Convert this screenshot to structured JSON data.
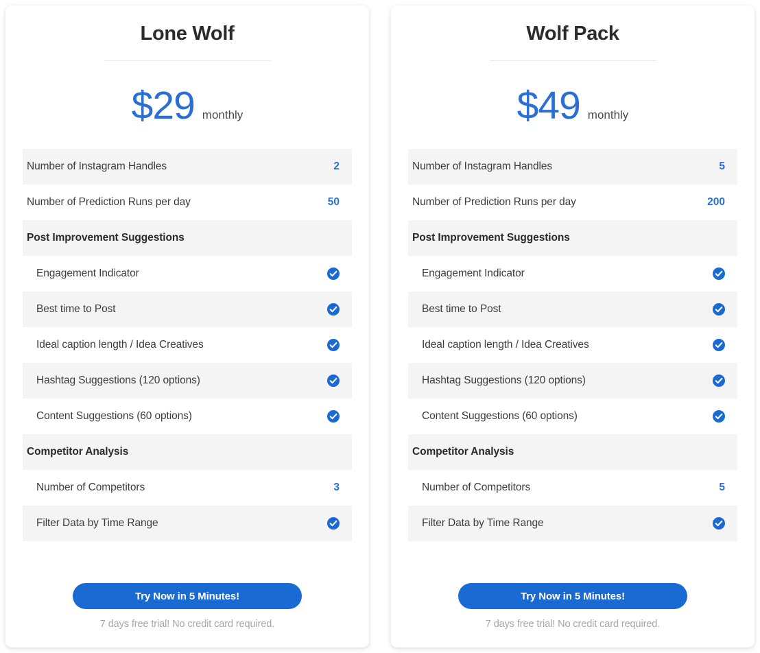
{
  "theme": {
    "accent_blue": "#2b6fd4",
    "button_blue": "#1a6ad4",
    "row_shade": "#f4f4f4",
    "page_background": "#ffffff",
    "text_primary": "#2b2b2b",
    "text_secondary": "#3d3d3d",
    "note_gray": "#a6a6a6"
  },
  "icons": {
    "check": "check-circle-icon"
  },
  "plans": [
    {
      "id": "lone-wolf",
      "title": "Lone Wolf",
      "price": "$29",
      "period": "monthly",
      "features": [
        {
          "label": "Number of Instagram Handles",
          "type": "value",
          "value": "2",
          "shaded": true,
          "indented": false,
          "header": false
        },
        {
          "label": "Number of Prediction Runs per day",
          "type": "value",
          "value": "50",
          "shaded": false,
          "indented": false,
          "header": false
        },
        {
          "label": "Post Improvement Suggestions",
          "type": "none",
          "value": "",
          "shaded": true,
          "indented": false,
          "header": true
        },
        {
          "label": "Engagement Indicator",
          "type": "check",
          "value": "",
          "shaded": false,
          "indented": true,
          "header": false
        },
        {
          "label": "Best time to Post",
          "type": "check",
          "value": "",
          "shaded": true,
          "indented": true,
          "header": false
        },
        {
          "label": "Ideal caption length / Idea Creatives",
          "type": "check",
          "value": "",
          "shaded": false,
          "indented": true,
          "header": false
        },
        {
          "label": "Hashtag Suggestions (120 options)",
          "type": "check",
          "value": "",
          "shaded": true,
          "indented": true,
          "header": false
        },
        {
          "label": "Content Suggestions (60 options)",
          "type": "check",
          "value": "",
          "shaded": false,
          "indented": true,
          "header": false
        },
        {
          "label": "Competitor Analysis",
          "type": "none",
          "value": "",
          "shaded": true,
          "indented": false,
          "header": true
        },
        {
          "label": "Number of Competitors",
          "type": "value",
          "value": "3",
          "shaded": false,
          "indented": true,
          "header": false
        },
        {
          "label": "Filter Data by Time Range",
          "type": "check",
          "value": "",
          "shaded": true,
          "indented": true,
          "header": false
        }
      ],
      "cta_label": "Try Now in 5 Minutes!",
      "cta_note": "7 days free trial! No credit card required."
    },
    {
      "id": "wolf-pack",
      "title": "Wolf Pack",
      "price": "$49",
      "period": "monthly",
      "features": [
        {
          "label": "Number of Instagram Handles",
          "type": "value",
          "value": "5",
          "shaded": true,
          "indented": false,
          "header": false
        },
        {
          "label": "Number of Prediction Runs per day",
          "type": "value",
          "value": "200",
          "shaded": false,
          "indented": false,
          "header": false
        },
        {
          "label": "Post Improvement Suggestions",
          "type": "none",
          "value": "",
          "shaded": true,
          "indented": false,
          "header": true
        },
        {
          "label": "Engagement Indicator",
          "type": "check",
          "value": "",
          "shaded": false,
          "indented": true,
          "header": false
        },
        {
          "label": "Best time to Post",
          "type": "check",
          "value": "",
          "shaded": true,
          "indented": true,
          "header": false
        },
        {
          "label": "Ideal caption length / Idea Creatives",
          "type": "check",
          "value": "",
          "shaded": false,
          "indented": true,
          "header": false
        },
        {
          "label": "Hashtag Suggestions (120 options)",
          "type": "check",
          "value": "",
          "shaded": true,
          "indented": true,
          "header": false
        },
        {
          "label": "Content Suggestions (60 options)",
          "type": "check",
          "value": "",
          "shaded": false,
          "indented": true,
          "header": false
        },
        {
          "label": "Competitor Analysis",
          "type": "none",
          "value": "",
          "shaded": true,
          "indented": false,
          "header": true
        },
        {
          "label": "Number of Competitors",
          "type": "value",
          "value": "5",
          "shaded": false,
          "indented": true,
          "header": false
        },
        {
          "label": "Filter Data by Time Range",
          "type": "check",
          "value": "",
          "shaded": true,
          "indented": true,
          "header": false
        }
      ],
      "cta_label": "Try Now in 5 Minutes!",
      "cta_note": "7 days free trial! No credit card required."
    }
  ]
}
